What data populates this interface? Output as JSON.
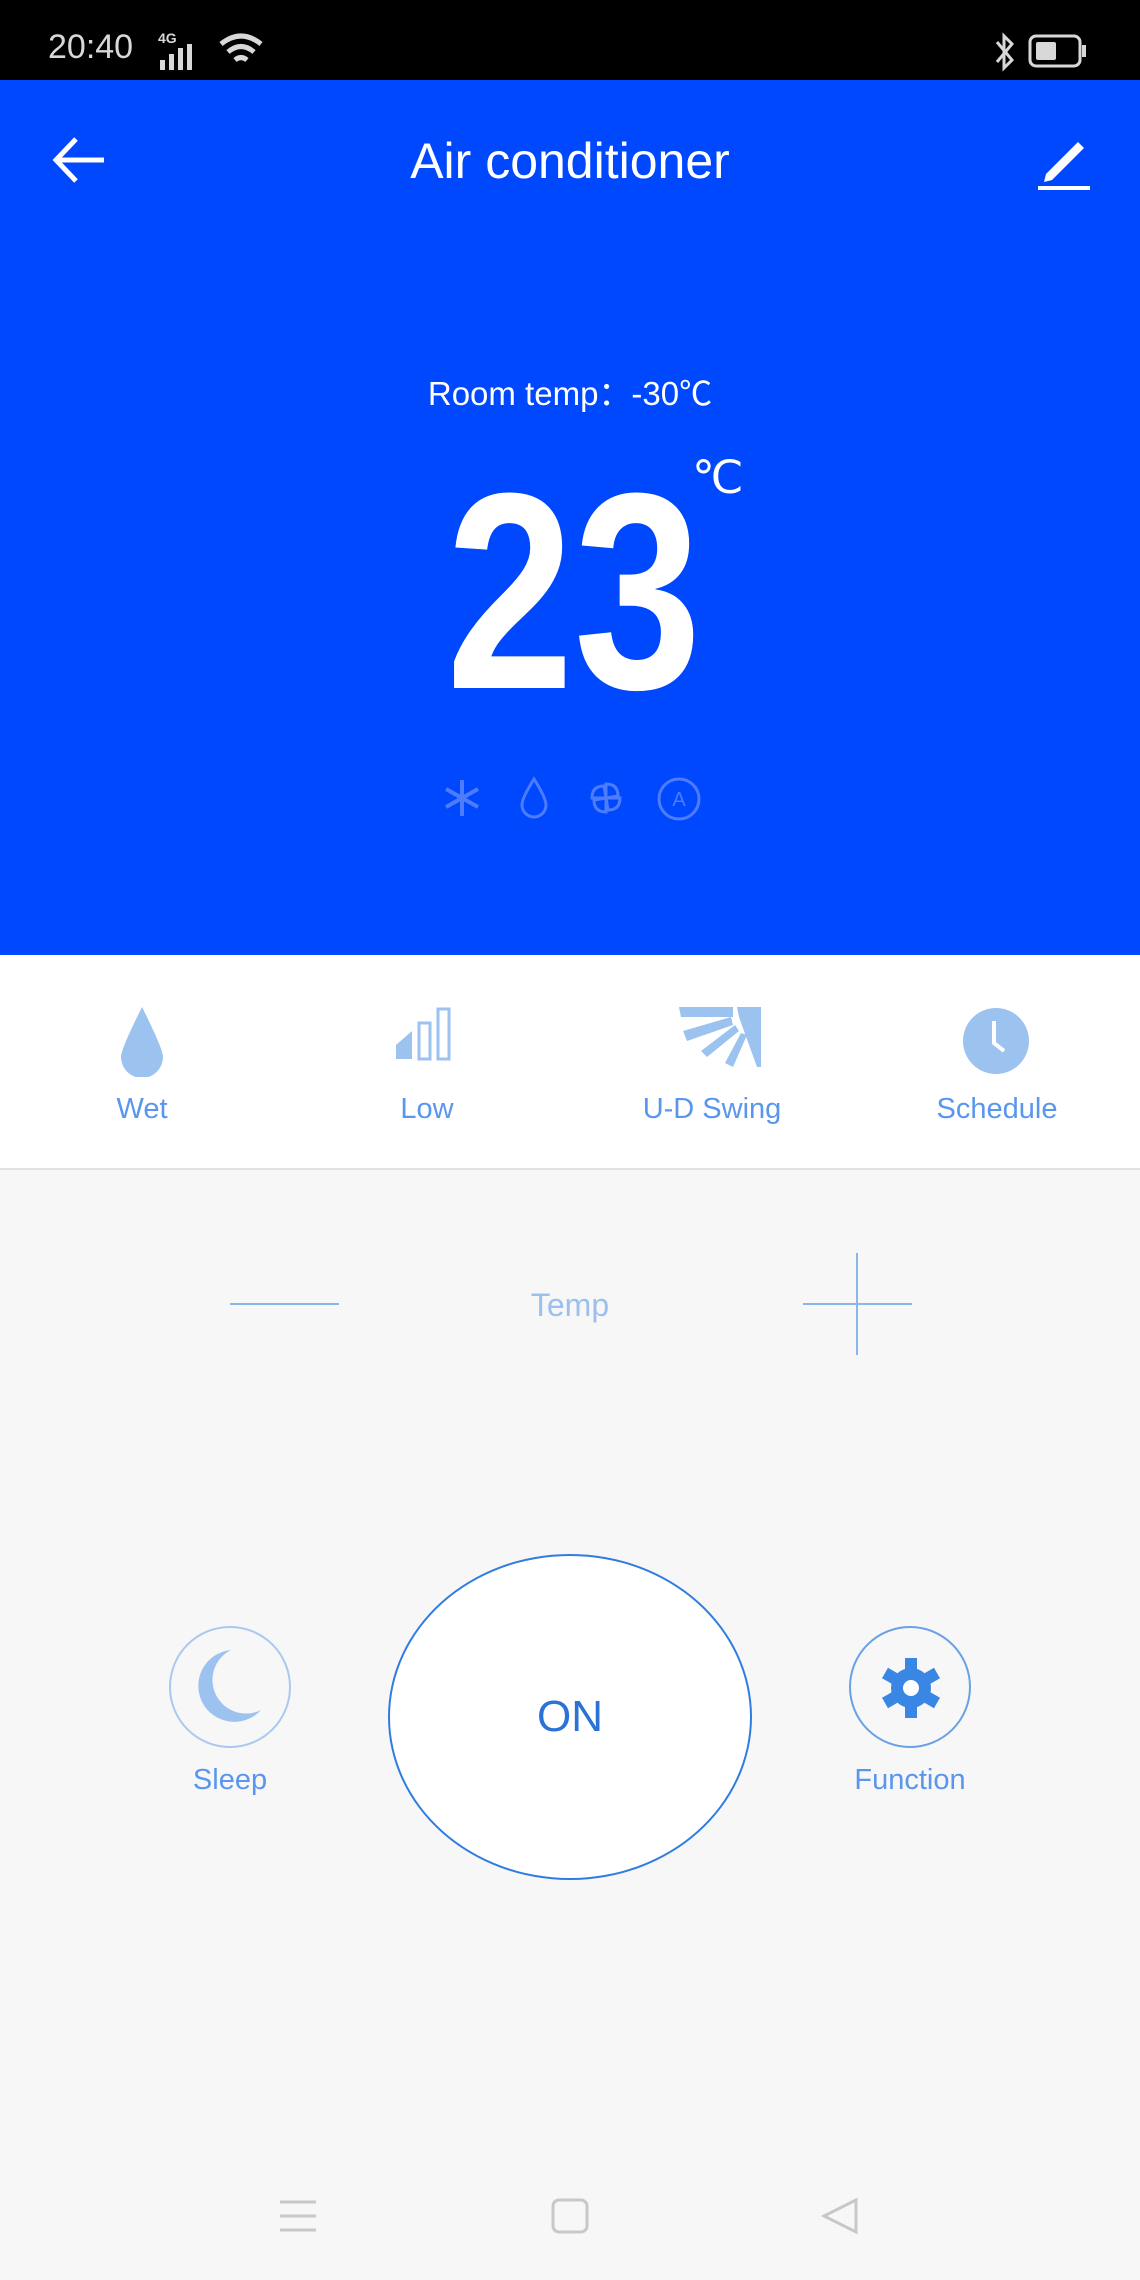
{
  "status_bar": {
    "time": "20:40",
    "network": "4G",
    "icons": [
      "signal-icon",
      "wifi-icon",
      "bluetooth-icon",
      "battery-icon"
    ]
  },
  "header": {
    "title": "Air conditioner",
    "back_icon": "arrow-left-icon",
    "edit_icon": "pencil-icon"
  },
  "display": {
    "room_temp": "Room temp：-30℃",
    "set_temp": "23",
    "unit": "℃",
    "mode_icons": [
      "snowflake-icon",
      "drop-icon",
      "fan-icon",
      "auto-icon"
    ]
  },
  "quick_controls": [
    {
      "label": "Wet",
      "icon": "drop-icon"
    },
    {
      "label": "Low",
      "icon": "fan-speed-icon"
    },
    {
      "label": "U-D Swing",
      "icon": "swing-icon"
    },
    {
      "label": "Schedule",
      "icon": "clock-icon"
    }
  ],
  "temp_control": {
    "label": "Temp"
  },
  "power": {
    "label": "ON"
  },
  "sleep": {
    "label": "Sleep"
  },
  "function": {
    "label": "Function"
  },
  "colors": {
    "header": "#0048fe",
    "accent": "#2a72d6",
    "light_accent": "#9cc2ef"
  }
}
